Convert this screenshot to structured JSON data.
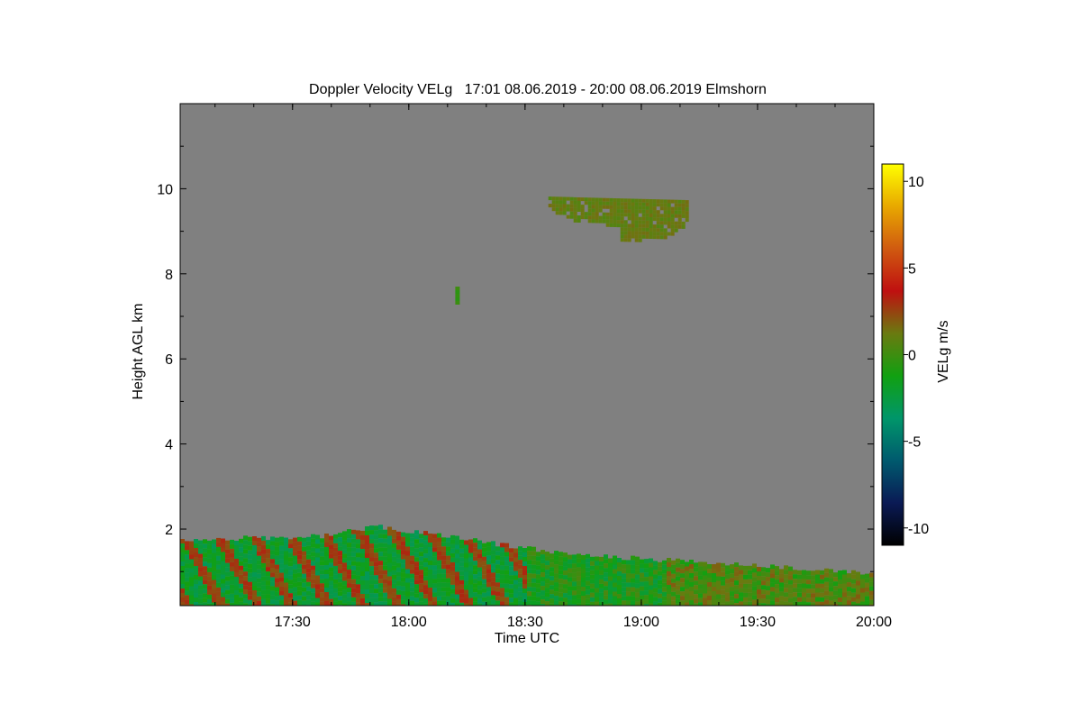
{
  "chart_data": {
    "type": "heatmap",
    "title": "Doppler Velocity VELg   17:01 08.06.2019 - 20:00 08.06.2019 Elmshorn",
    "xlabel": "Time UTC",
    "ylabel": "Height AGL km",
    "colorbar_label": "VELg m/s",
    "xlim": [
      "17:01",
      "20:00"
    ],
    "ylim": [
      0.2,
      12
    ],
    "x_ticks": [
      "17:30",
      "18:00",
      "18:30",
      "19:00",
      "19:30",
      "20:00"
    ],
    "y_ticks": [
      2,
      4,
      6,
      8,
      10
    ],
    "colorbar_range": [
      -11,
      11
    ],
    "colorbar_ticks": [
      10,
      5,
      0,
      -5,
      -10
    ],
    "colorbar_tick_labels": [
      "10",
      "5",
      "0",
      "-5",
      "-10"
    ],
    "colormap": [
      "#000000",
      "#0a1a55",
      "#005a6e",
      "#00966a",
      "#11a011",
      "#6a7a10",
      "#bf1010",
      "#d05a10",
      "#e8a800",
      "#ffff00"
    ],
    "background_color": "#808080",
    "grid": false,
    "features": [
      {
        "label": "boundary layer echoes",
        "time_range": [
          "17:01",
          "20:00"
        ],
        "height_km": [
          0.2,
          2.1
        ],
        "velocity_m_s": [
          -4,
          3
        ]
      },
      {
        "label": "upper cloud",
        "time_range": [
          "18:36",
          "19:12"
        ],
        "height_km": [
          8.7,
          9.9
        ],
        "velocity_m_s": [
          0.5,
          1.5
        ]
      },
      {
        "label": "small echo",
        "time_range": [
          "18:12",
          "18:13"
        ],
        "height_km": [
          7.3,
          7.7
        ],
        "velocity_m_s": [
          -1,
          0
        ]
      }
    ]
  }
}
